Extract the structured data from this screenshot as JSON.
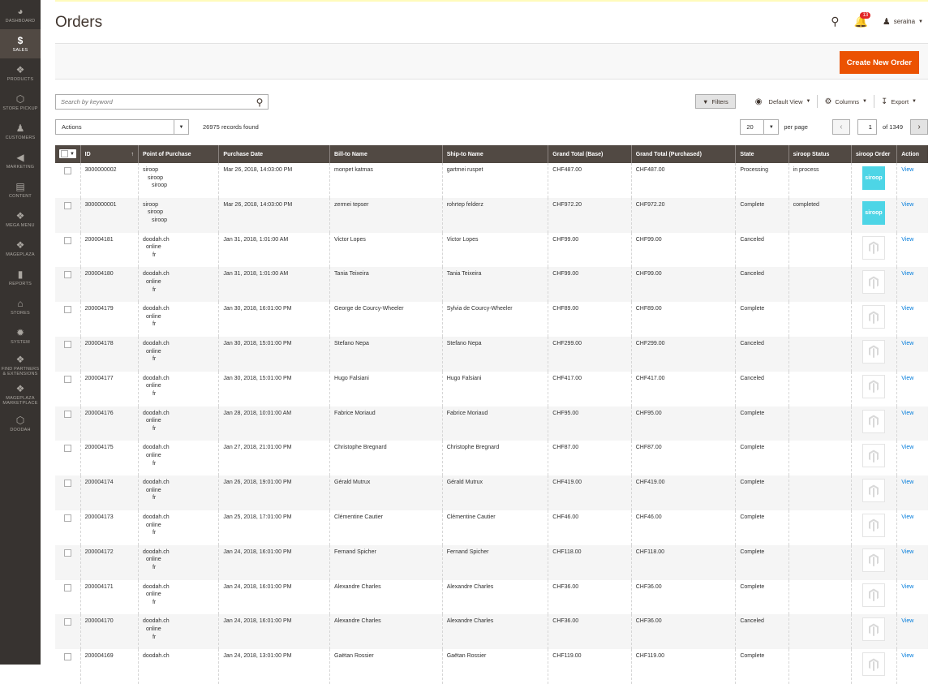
{
  "sidebar": {
    "items": [
      {
        "label": "DASHBOARD",
        "icon": "dashboard-icon",
        "glyph": "◕",
        "active": false
      },
      {
        "label": "SALES",
        "icon": "dollar-icon",
        "glyph": "$",
        "active": true
      },
      {
        "label": "PRODUCTS",
        "icon": "cube-icon",
        "glyph": "❖",
        "active": false
      },
      {
        "label": "STORE PICKUP",
        "icon": "hexagon-icon",
        "glyph": "⬡",
        "active": false
      },
      {
        "label": "CUSTOMERS",
        "icon": "person-icon",
        "glyph": "♟",
        "active": false
      },
      {
        "label": "MARKETING",
        "icon": "megaphone-icon",
        "glyph": "◀",
        "active": false
      },
      {
        "label": "CONTENT",
        "icon": "layout-icon",
        "glyph": "▤",
        "active": false
      },
      {
        "label": "MEGA MENU",
        "icon": "cube-icon",
        "glyph": "❖",
        "active": false
      },
      {
        "label": "MAGEPLAZA",
        "icon": "cube-icon",
        "glyph": "❖",
        "active": false
      },
      {
        "label": "REPORTS",
        "icon": "bar-chart-icon",
        "glyph": "▮",
        "active": false
      },
      {
        "label": "STORES",
        "icon": "store-icon",
        "glyph": "⌂",
        "active": false
      },
      {
        "label": "SYSTEM",
        "icon": "gear-icon",
        "glyph": "✹",
        "active": false
      },
      {
        "label": "FIND PARTNERS & EXTENSIONS",
        "icon": "cube-icon",
        "glyph": "❖",
        "active": false
      },
      {
        "label": "MAGEPLAZA MARKETPLACE",
        "icon": "cube-icon",
        "glyph": "❖",
        "active": false
      },
      {
        "label": "DOODAH",
        "icon": "hexagon-icon",
        "glyph": "⬡",
        "active": false
      }
    ]
  },
  "header": {
    "title": "Orders",
    "notification_count": "13",
    "username": "seraina"
  },
  "page_actions": {
    "create_label": "Create New Order"
  },
  "toolbar": {
    "search_placeholder": "Search by keyword",
    "filters_label": "Filters",
    "view_label": "Default View",
    "columns_label": "Columns",
    "export_label": "Export",
    "actions_label": "Actions",
    "records_found": "26975 records found",
    "per_page_value": "20",
    "per_page_label": "per page",
    "current_page": "1",
    "total_pages": "of 1349"
  },
  "grid": {
    "columns": [
      "ID",
      "Point of Purchase",
      "Purchase Date",
      "Bill-to Name",
      "Ship-to Name",
      "Grand Total (Base)",
      "Grand Total (Purchased)",
      "State",
      "siroop Status",
      "siroop Order",
      "Action"
    ],
    "logo_text": "siroop",
    "rows": [
      {
        "id": "3000000002",
        "pop": [
          "siroop",
          "siroop",
          "siroop"
        ],
        "date": "Mar 26, 2018, 14:03:00 PM",
        "bill": "monpet katmas",
        "ship": "gartmei ruspet",
        "base": "CHF487.00",
        "purchased": "CHF487.00",
        "state": "Processing",
        "siroop_status": "in process",
        "logo": "siroop",
        "action": "View"
      },
      {
        "id": "3000000001",
        "pop": [
          "siroop",
          "siroop",
          "siroop"
        ],
        "date": "Mar 26, 2018, 14:03:00 PM",
        "bill": "zermei tepser",
        "ship": "rohrtep felderz",
        "base": "CHF972.20",
        "purchased": "CHF972.20",
        "state": "Complete",
        "siroop_status": "completed",
        "logo": "siroop",
        "action": "View"
      },
      {
        "id": "200004181",
        "pop": [
          "doodah.ch",
          "online",
          "fr"
        ],
        "date": "Jan 31, 2018, 1:01:00 AM",
        "bill": "Victor Lopes",
        "ship": "Victor Lopes",
        "base": "CHF99.00",
        "purchased": "CHF99.00",
        "state": "Canceled",
        "siroop_status": "",
        "logo": "magento",
        "action": "View"
      },
      {
        "id": "200004180",
        "pop": [
          "doodah.ch",
          "online",
          "fr"
        ],
        "date": "Jan 31, 2018, 1:01:00 AM",
        "bill": "Tania Teixeira",
        "ship": "Tania Teixeira",
        "base": "CHF99.00",
        "purchased": "CHF99.00",
        "state": "Canceled",
        "siroop_status": "",
        "logo": "magento",
        "action": "View"
      },
      {
        "id": "200004179",
        "pop": [
          "doodah.ch",
          "online",
          "fr"
        ],
        "date": "Jan 30, 2018, 16:01:00 PM",
        "bill": "George de Courcy-Wheeler",
        "ship": "Sylvia de Courcy-Wheeler",
        "base": "CHF89.00",
        "purchased": "CHF89.00",
        "state": "Complete",
        "siroop_status": "",
        "logo": "magento",
        "action": "View"
      },
      {
        "id": "200004178",
        "pop": [
          "doodah.ch",
          "online",
          "fr"
        ],
        "date": "Jan 30, 2018, 15:01:00 PM",
        "bill": "Stefano Nepa",
        "ship": "Stefano Nepa",
        "base": "CHF299.00",
        "purchased": "CHF299.00",
        "state": "Canceled",
        "siroop_status": "",
        "logo": "magento",
        "action": "View"
      },
      {
        "id": "200004177",
        "pop": [
          "doodah.ch",
          "online",
          "fr"
        ],
        "date": "Jan 30, 2018, 15:01:00 PM",
        "bill": "Hugo Falsiani",
        "ship": "Hugo Falsiani",
        "base": "CHF417.00",
        "purchased": "CHF417.00",
        "state": "Canceled",
        "siroop_status": "",
        "logo": "magento",
        "action": "View"
      },
      {
        "id": "200004176",
        "pop": [
          "doodah.ch",
          "online",
          "fr"
        ],
        "date": "Jan 28, 2018, 10:01:00 AM",
        "bill": "Fabrice Moriaud",
        "ship": "Fabrice Moriaud",
        "base": "CHF95.00",
        "purchased": "CHF95.00",
        "state": "Complete",
        "siroop_status": "",
        "logo": "magento",
        "action": "View"
      },
      {
        "id": "200004175",
        "pop": [
          "doodah.ch",
          "online",
          "fr"
        ],
        "date": "Jan 27, 2018, 21:01:00 PM",
        "bill": "Christophe Bregnard",
        "ship": "Christophe Bregnard",
        "base": "CHF87.00",
        "purchased": "CHF87.00",
        "state": "Complete",
        "siroop_status": "",
        "logo": "magento",
        "action": "View"
      },
      {
        "id": "200004174",
        "pop": [
          "doodah.ch",
          "online",
          "fr"
        ],
        "date": "Jan 26, 2018, 19:01:00 PM",
        "bill": "Gérald Mutrux",
        "ship": "Gérald Mutrux",
        "base": "CHF419.00",
        "purchased": "CHF419.00",
        "state": "Complete",
        "siroop_status": "",
        "logo": "magento",
        "action": "View"
      },
      {
        "id": "200004173",
        "pop": [
          "doodah.ch",
          "online",
          "fr"
        ],
        "date": "Jan 25, 2018, 17:01:00 PM",
        "bill": "Clémentine Cautier",
        "ship": "Clémentine Cautier",
        "base": "CHF46.00",
        "purchased": "CHF46.00",
        "state": "Complete",
        "siroop_status": "",
        "logo": "magento",
        "action": "View"
      },
      {
        "id": "200004172",
        "pop": [
          "doodah.ch",
          "online",
          "fr"
        ],
        "date": "Jan 24, 2018, 16:01:00 PM",
        "bill": "Fernand Spicher",
        "ship": "Fernand Spicher",
        "base": "CHF118.00",
        "purchased": "CHF118.00",
        "state": "Complete",
        "siroop_status": "",
        "logo": "magento",
        "action": "View"
      },
      {
        "id": "200004171",
        "pop": [
          "doodah.ch",
          "online",
          "fr"
        ],
        "date": "Jan 24, 2018, 16:01:00 PM",
        "bill": "Alexandre Charles",
        "ship": "Alexandre Charles",
        "base": "CHF36.00",
        "purchased": "CHF36.00",
        "state": "Complete",
        "siroop_status": "",
        "logo": "magento",
        "action": "View"
      },
      {
        "id": "200004170",
        "pop": [
          "doodah.ch",
          "online",
          "fr"
        ],
        "date": "Jan 24, 2018, 16:01:00 PM",
        "bill": "Alexandre Charles",
        "ship": "Alexandre Charles",
        "base": "CHF36.00",
        "purchased": "CHF36.00",
        "state": "Canceled",
        "siroop_status": "",
        "logo": "magento",
        "action": "View"
      },
      {
        "id": "200004169",
        "pop": [
          "doodah.ch",
          "",
          ""
        ],
        "date": "Jan 24, 2018, 13:01:00 PM",
        "bill": "Gaëtan Rossier",
        "ship": "Gaëtan Rossier",
        "base": "CHF119.00",
        "purchased": "CHF119.00",
        "state": "Complete",
        "siroop_status": "",
        "logo": "magento",
        "action": "View"
      }
    ]
  },
  "colors": {
    "sidebar": "#373330",
    "sidebar_active": "#514943",
    "accent": "#eb5202",
    "link": "#007bdb",
    "siroop": "#4dd5e6"
  }
}
